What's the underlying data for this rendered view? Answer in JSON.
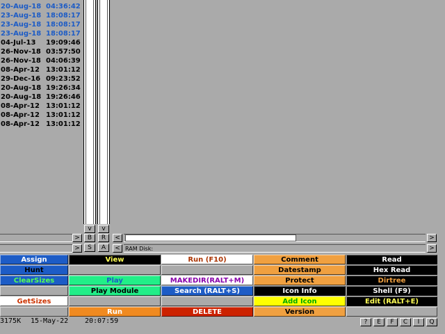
{
  "file_list": [
    {
      "date": "20-Aug-18",
      "time": "04:36:42",
      "selected": true
    },
    {
      "date": "23-Aug-18",
      "time": "18:08:17",
      "selected": true
    },
    {
      "date": "23-Aug-18",
      "time": "18:08:17",
      "selected": true
    },
    {
      "date": "23-Aug-18",
      "time": "18:08:17",
      "selected": true
    },
    {
      "date": "04-Jul-13",
      "time": "19:09:46",
      "selected": false
    },
    {
      "date": "26-Nov-18",
      "time": "03:57:50",
      "selected": false
    },
    {
      "date": "26-Nov-18",
      "time": "04:06:39",
      "selected": false
    },
    {
      "date": "08-Apr-12",
      "time": "13:01:12",
      "selected": false
    },
    {
      "date": "29-Dec-16",
      "time": "09:23:52",
      "selected": false
    },
    {
      "date": "20-Aug-18",
      "time": "19:26:34",
      "selected": false
    },
    {
      "date": "20-Aug-18",
      "time": "19:26:46",
      "selected": false
    },
    {
      "date": "08-Apr-12",
      "time": "13:01:12",
      "selected": false
    },
    {
      "date": "08-Apr-12",
      "time": "13:01:12",
      "selected": false
    },
    {
      "date": "08-Apr-12",
      "time": "13:01:12",
      "selected": false
    }
  ],
  "scroll_buttons": {
    "b": "B",
    "r": "R",
    "s": "S",
    "a": "A",
    "up": "^",
    "down": "v",
    "left": "<",
    "right": ">"
  },
  "path_bar": {
    "text": "RAM Disk:"
  },
  "commands": [
    {
      "id": "assign",
      "label": "Assign",
      "bg": "#1d5cc6",
      "fg": "#ffffff"
    },
    {
      "id": "view",
      "label": "View",
      "bg": "#000000",
      "fg": "#ffff55"
    },
    {
      "id": "run-f10",
      "label": "Run (F10)",
      "bg": "#ffffff",
      "fg": "#aa3300"
    },
    {
      "id": "comment",
      "label": "Comment",
      "bg": "#f0a040",
      "fg": "#000000"
    },
    {
      "id": "read",
      "label": "Read",
      "bg": "#000000",
      "fg": "#ffffff"
    },
    {
      "id": "hunt",
      "label": "Hunt",
      "bg": "#1d5cc6",
      "fg": "#000000"
    },
    {
      "id": "blank-1",
      "label": "",
      "bg": "#aaaaaa",
      "fg": "#000000"
    },
    {
      "id": "blank-2",
      "label": "",
      "bg": "#aaaaaa",
      "fg": "#000000"
    },
    {
      "id": "datestamp",
      "label": "Datestamp",
      "bg": "#f0a040",
      "fg": "#000000"
    },
    {
      "id": "hex-read",
      "label": "Hex Read",
      "bg": "#000000",
      "fg": "#ffffff"
    },
    {
      "id": "clearsizes",
      "label": "ClearSizes",
      "bg": "#1d5cc6",
      "fg": "#55ff55"
    },
    {
      "id": "play",
      "label": "Play",
      "bg": "#22ee88",
      "fg": "#1d5cc6"
    },
    {
      "id": "makedir",
      "label": "MAKEDIR(RALT+M)",
      "bg": "#ffffff",
      "fg": "#8800aa"
    },
    {
      "id": "protect",
      "label": "Protect",
      "bg": "#f0a040",
      "fg": "#000000"
    },
    {
      "id": "dirtree",
      "label": "Dirtree",
      "bg": "#000000",
      "fg": "#f0a040"
    },
    {
      "id": "blank-3",
      "label": "",
      "bg": "#aaaaaa",
      "fg": "#000000"
    },
    {
      "id": "play-module",
      "label": "Play Module",
      "bg": "#22ee88",
      "fg": "#000000"
    },
    {
      "id": "search",
      "label": "Search (RALT+S)",
      "bg": "#1d5cc6",
      "fg": "#ffffff"
    },
    {
      "id": "icon-info",
      "label": "Icon Info",
      "bg": "#000000",
      "fg": "#ffffff"
    },
    {
      "id": "shell-f9",
      "label": "Shell (F9)",
      "bg": "#000000",
      "fg": "#ffffff"
    },
    {
      "id": "getsizes",
      "label": "GetSizes",
      "bg": "#ffffff",
      "fg": "#cc3300"
    },
    {
      "id": "blank-4",
      "label": "",
      "bg": "#aaaaaa",
      "fg": "#000000"
    },
    {
      "id": "blank-5",
      "label": "",
      "bg": "#aaaaaa",
      "fg": "#000000"
    },
    {
      "id": "add-icon",
      "label": "Add Icon",
      "bg": "#ffff00",
      "fg": "#00aa00"
    },
    {
      "id": "edit",
      "label": "Edit (RALT+E)",
      "bg": "#000000",
      "fg": "#ffff55"
    },
    {
      "id": "blank-6",
      "label": "",
      "bg": "#aaaaaa",
      "fg": "#000000"
    },
    {
      "id": "run",
      "label": "Run",
      "bg": "#f08a20",
      "fg": "#ffffff"
    },
    {
      "id": "delete",
      "label": "DELETE",
      "bg": "#cc2200",
      "fg": "#ffffff"
    },
    {
      "id": "version",
      "label": "Version",
      "bg": "#f0a040",
      "fg": "#000000"
    },
    {
      "id": "blank-7",
      "label": "",
      "bg": "#aaaaaa",
      "fg": "#000000"
    }
  ],
  "status": {
    "memory": "3175K",
    "date": "15-May-22",
    "time": "20:07:59"
  },
  "status_buttons": [
    "?",
    "E",
    "F",
    "C",
    "I",
    "Q"
  ]
}
